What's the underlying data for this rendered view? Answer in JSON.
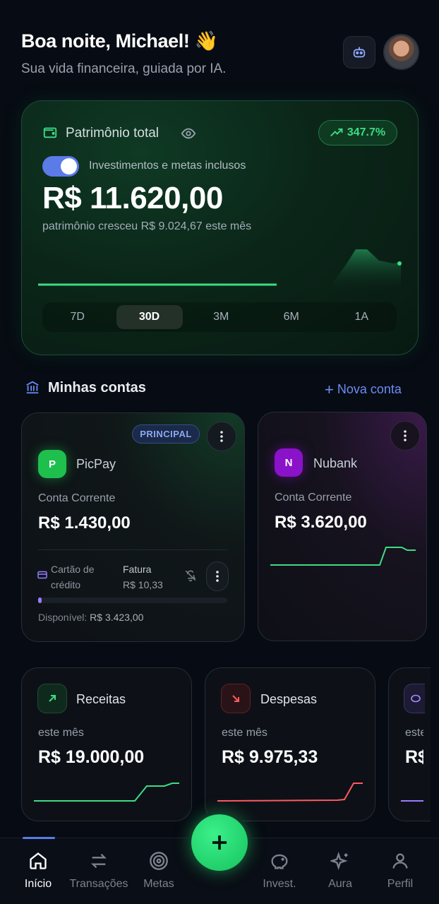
{
  "header": {
    "greeting": "Boa noite, Michael! 👋",
    "subtitle": "Sua vida financeira, guiada por IA."
  },
  "patrimonio": {
    "title": "Patrimônio total",
    "change_badge": "347.7%",
    "toggle_label": "Investimentos e metas inclusos",
    "toggle_on": true,
    "amount": "R$ 11.620,00",
    "growth_text": "patrimônio cresceu R$ 9.024,67 este mês",
    "ranges": [
      "7D",
      "30D",
      "3M",
      "6M",
      "1A"
    ],
    "active_range": "30D",
    "accent_color": "#3ddc84"
  },
  "accounts_section": {
    "title": "Minhas contas",
    "new_account": "Nova conta"
  },
  "accounts": [
    {
      "badge": "PRINCIPAL",
      "logo_letter": "P",
      "logo_color": "#1fbf4e",
      "name": "PicPay",
      "type": "Conta Corrente",
      "balance": "R$ 1.430,00",
      "credit_label": "Cartão de crédito",
      "fatura_label": "Fatura",
      "fatura_value": "R$ 10,33",
      "credit_used_fraction": 0.02,
      "available_label": "Disponível:",
      "available_value": "R$ 3.423,00"
    },
    {
      "logo_letter": "N",
      "logo_color": "#8a12c9",
      "name": "Nubank",
      "type": "Conta Corrente",
      "balance": "R$ 3.620,00"
    }
  ],
  "stats": [
    {
      "title": "Receitas",
      "period": "este mês",
      "value": "R$ 19.000,00",
      "color": "#3ddc84"
    },
    {
      "title": "Despesas",
      "period": "este mês",
      "value": "R$ 9.975,33",
      "color": "#ff5a5f"
    },
    {
      "title": "",
      "period": "este mês",
      "value": "R$",
      "color": "#9a7bff"
    }
  ],
  "nav": {
    "items": [
      "Início",
      "Transações",
      "Metas",
      "Invest.",
      "Aura",
      "Perfil"
    ],
    "active": "Início"
  }
}
